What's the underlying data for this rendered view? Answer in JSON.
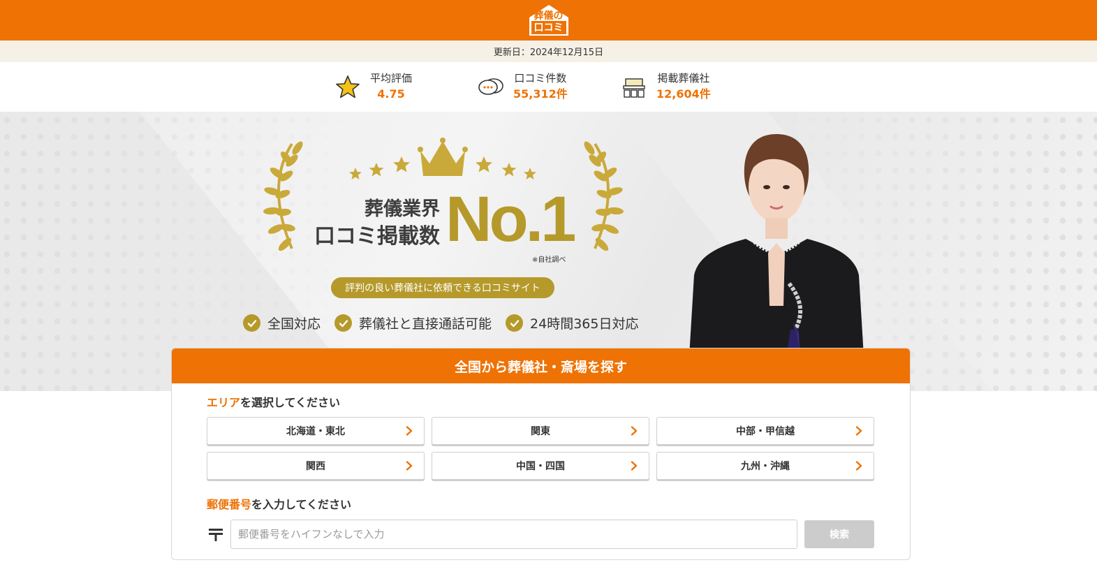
{
  "logo": {
    "line1": "葬儀の",
    "line2": "口コミ"
  },
  "update": {
    "label": "更新日：2024年12月15日"
  },
  "stats": [
    {
      "label": "平均評価",
      "value": "4.75",
      "icon": "star-icon"
    },
    {
      "label": "口コミ件数",
      "value": "55,312件",
      "icon": "chat-bubbles-icon"
    },
    {
      "label": "掲載葬儀社",
      "value": "12,604件",
      "icon": "funeral-hall-icon"
    }
  ],
  "hero": {
    "line1": "葬儀業界",
    "line2": "口コミ掲載数",
    "big": "No.1",
    "note": "※自社調べ",
    "pill": "評判の良い葬儀社に依頼できる口コミサイト",
    "features": [
      "全国対応",
      "葬儀社と直接通話可能",
      "24時間365日対応"
    ]
  },
  "search": {
    "header": "全国から葬儀社・斎場を探す",
    "area_title_hl": "エリア",
    "area_title_rest": "を選択してください",
    "areas": [
      "北海道・東北",
      "関東",
      "中部・甲信越",
      "関西",
      "中国・四国",
      "九州・沖縄"
    ],
    "zip_title_hl": "郵便番号",
    "zip_title_rest": "を入力してください",
    "zip_placeholder": "郵便番号をハイフンなしで入力",
    "search_button": "検索"
  },
  "colors": {
    "brand": "#ee7204",
    "gold": "#b5992a",
    "datebar": "#f5f1e6"
  }
}
